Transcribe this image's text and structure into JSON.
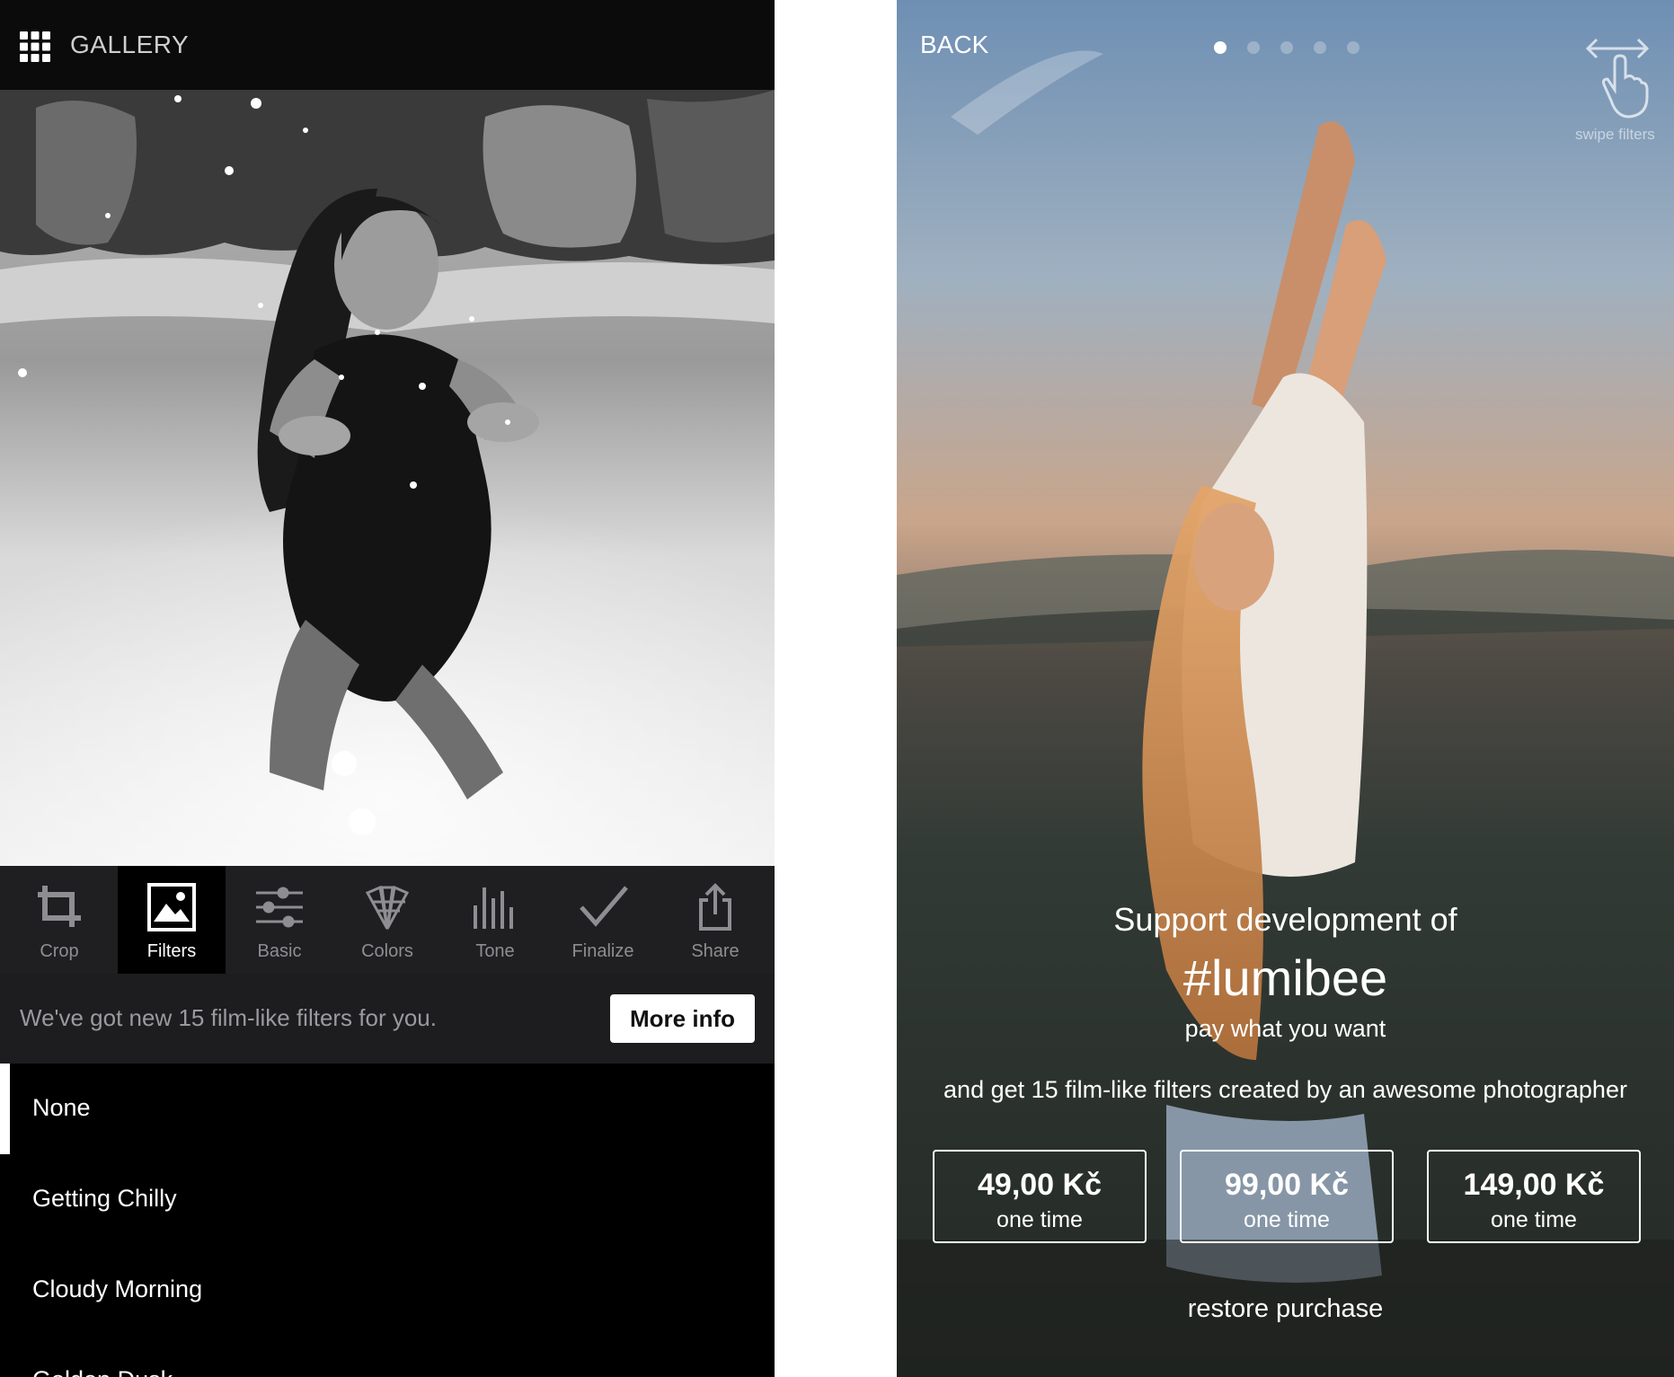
{
  "editor": {
    "topbar": {
      "menu_icon": "grid-icon",
      "title": "GALLERY"
    },
    "photo": {
      "description_icon": "photo-beach-woman-bw"
    },
    "tools": [
      {
        "label": "Crop",
        "icon": "crop-icon",
        "active": false
      },
      {
        "label": "Filters",
        "icon": "image-icon",
        "active": true
      },
      {
        "label": "Basic",
        "icon": "sliders-icon",
        "active": false
      },
      {
        "label": "Colors",
        "icon": "palette-icon",
        "active": false
      },
      {
        "label": "Tone",
        "icon": "bars-icon",
        "active": false
      },
      {
        "label": "Finalize",
        "icon": "check-icon",
        "active": false
      },
      {
        "label": "Share",
        "icon": "share-icon",
        "active": false
      }
    ],
    "promo": {
      "text": "We've got new 15 film-like filters for you.",
      "button": "More info"
    },
    "filters": [
      {
        "label": "None",
        "selected": true
      },
      {
        "label": "Getting Chilly",
        "selected": false
      },
      {
        "label": "Cloudy Morning",
        "selected": false
      },
      {
        "label": "Golden Dusk",
        "selected": false
      }
    ]
  },
  "purchase": {
    "back": "BACK",
    "page_dots": {
      "count": 5,
      "active_index": 0
    },
    "swipe_hint": {
      "icon": "swipe-hand-icon",
      "label": "swipe filters"
    },
    "headline": "Support development of",
    "hashtag": "#lumibee",
    "subheadline": "pay what you want",
    "description": "and get 15 film-like filters created by an awesome photographer",
    "prices": [
      {
        "amount": "49,00 Kč",
        "period": "one time"
      },
      {
        "amount": "99,00 Kč",
        "period": "one time"
      },
      {
        "amount": "149,00 Kč",
        "period": "one time"
      }
    ],
    "restore": "restore purchase"
  },
  "colors": {
    "background": "#000000",
    "toolbar": "#1f1f21",
    "promo_bar": "#1d1d1f",
    "inactive_label": "#8e8e92",
    "accent": "#ffffff"
  }
}
